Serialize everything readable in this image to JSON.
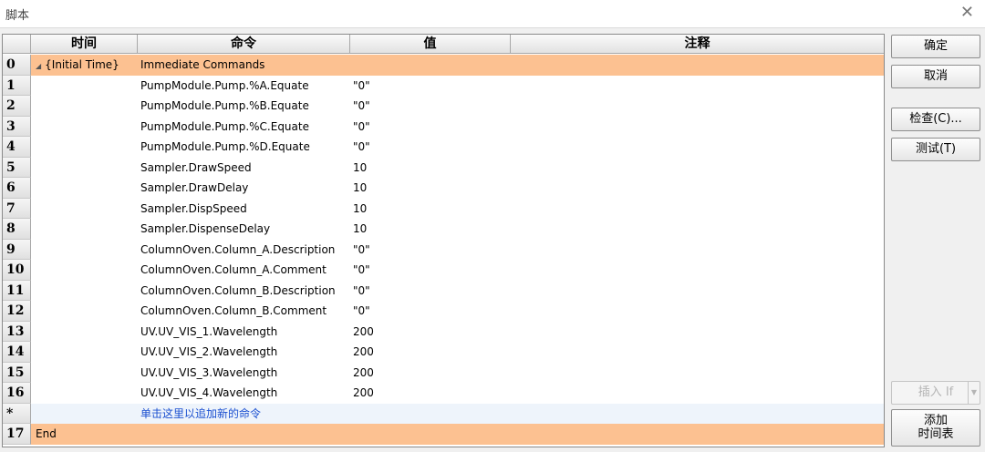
{
  "window": {
    "title": "脚本",
    "close_symbol": "✕"
  },
  "columns": {
    "time": "时间",
    "command": "命令",
    "value": "值",
    "comment": "注释"
  },
  "rows": [
    {
      "num": "0",
      "time": "{Initial Time}",
      "command": "Immediate Commands",
      "value": "",
      "style": "orange"
    },
    {
      "num": "1",
      "time": "",
      "command": "PumpModule.Pump.%A.Equate",
      "value": "\"0\""
    },
    {
      "num": "2",
      "time": "",
      "command": "PumpModule.Pump.%B.Equate",
      "value": "\"0\""
    },
    {
      "num": "3",
      "time": "",
      "command": "PumpModule.Pump.%C.Equate",
      "value": "\"0\""
    },
    {
      "num": "4",
      "time": "",
      "command": "PumpModule.Pump.%D.Equate",
      "value": "\"0\""
    },
    {
      "num": "5",
      "time": "",
      "command": "Sampler.DrawSpeed",
      "value": "10"
    },
    {
      "num": "6",
      "time": "",
      "command": "Sampler.DrawDelay",
      "value": "10"
    },
    {
      "num": "7",
      "time": "",
      "command": "Sampler.DispSpeed",
      "value": "10"
    },
    {
      "num": "8",
      "time": "",
      "command": "Sampler.DispenseDelay",
      "value": "10"
    },
    {
      "num": "9",
      "time": "",
      "command": "ColumnOven.Column_A.Description",
      "value": "\"0\""
    },
    {
      "num": "10",
      "time": "",
      "command": "ColumnOven.Column_A.Comment",
      "value": "\"0\""
    },
    {
      "num": "11",
      "time": "",
      "command": "ColumnOven.Column_B.Description",
      "value": "\"0\""
    },
    {
      "num": "12",
      "time": "",
      "command": "ColumnOven.Column_B.Comment",
      "value": "\"0\""
    },
    {
      "num": "13",
      "time": "",
      "command": "UV.UV_VIS_1.Wavelength",
      "value": "200"
    },
    {
      "num": "14",
      "time": "",
      "command": "UV.UV_VIS_2.Wavelength",
      "value": "200"
    },
    {
      "num": "15",
      "time": "",
      "command": "UV.UV_VIS_3.Wavelength",
      "value": "200"
    },
    {
      "num": "16",
      "time": "",
      "command": "UV.UV_VIS_4.Wavelength",
      "value": "200"
    },
    {
      "num": "*",
      "time": "",
      "command": "单击这里以追加新的命令",
      "value": "",
      "style": "newrow"
    },
    {
      "num": "17",
      "time": "End",
      "command": "",
      "value": "",
      "style": "orange"
    }
  ],
  "buttons": {
    "ok": "确定",
    "cancel": "取消",
    "check": "检查(C)...",
    "test": "测试(T)",
    "insert_if": "插入 If",
    "add_timetable_line1": "添加",
    "add_timetable_line2": "时间表"
  },
  "colors": {
    "highlight_row": "#fcc191",
    "new_command_text": "#1a4fd0"
  }
}
